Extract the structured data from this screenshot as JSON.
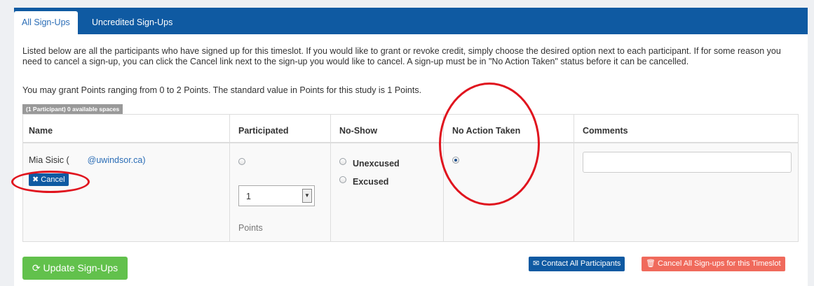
{
  "tabs": [
    {
      "label": "All Sign-Ups"
    },
    {
      "label": "Uncredited Sign-Ups"
    }
  ],
  "intro_text": "Listed below are all the participants who have signed up for this timeslot. If you would like to grant or revoke credit, simply choose the desired option next to each participant. If for some reason you need to cancel a sign-up, you can click the Cancel link next to the sign-up you would like to cancel. A sign-up must be in \"No Action Taken\" status before it can be cancelled.",
  "points_info": "You may grant Points ranging from 0 to 2 Points. The standard value in Points for this study is 1 Points.",
  "participants_badge": "(1 Participant) 0 available spaces",
  "table": {
    "headers": [
      "Name",
      "Participated",
      "No-Show",
      "No Action Taken",
      "Comments"
    ],
    "row": {
      "name": "Mia Sisic (",
      "email": "@uwindsor.ca)",
      "cancel_label": "Cancel",
      "points_value": "1",
      "points_label": "Points",
      "noshow_options": [
        "Unexcused",
        "Excused"
      ],
      "selected_status": "No Action Taken",
      "comment_value": ""
    }
  },
  "buttons": {
    "update": "Update Sign-Ups",
    "contact_all": "Contact All Participants",
    "cancel_all": "Cancel All Sign-ups for this Timeslot"
  },
  "colors": {
    "primary": "#0f5aa2",
    "success": "#62c14c",
    "danger": "#f06a5c",
    "annotation": "#e0141e"
  }
}
